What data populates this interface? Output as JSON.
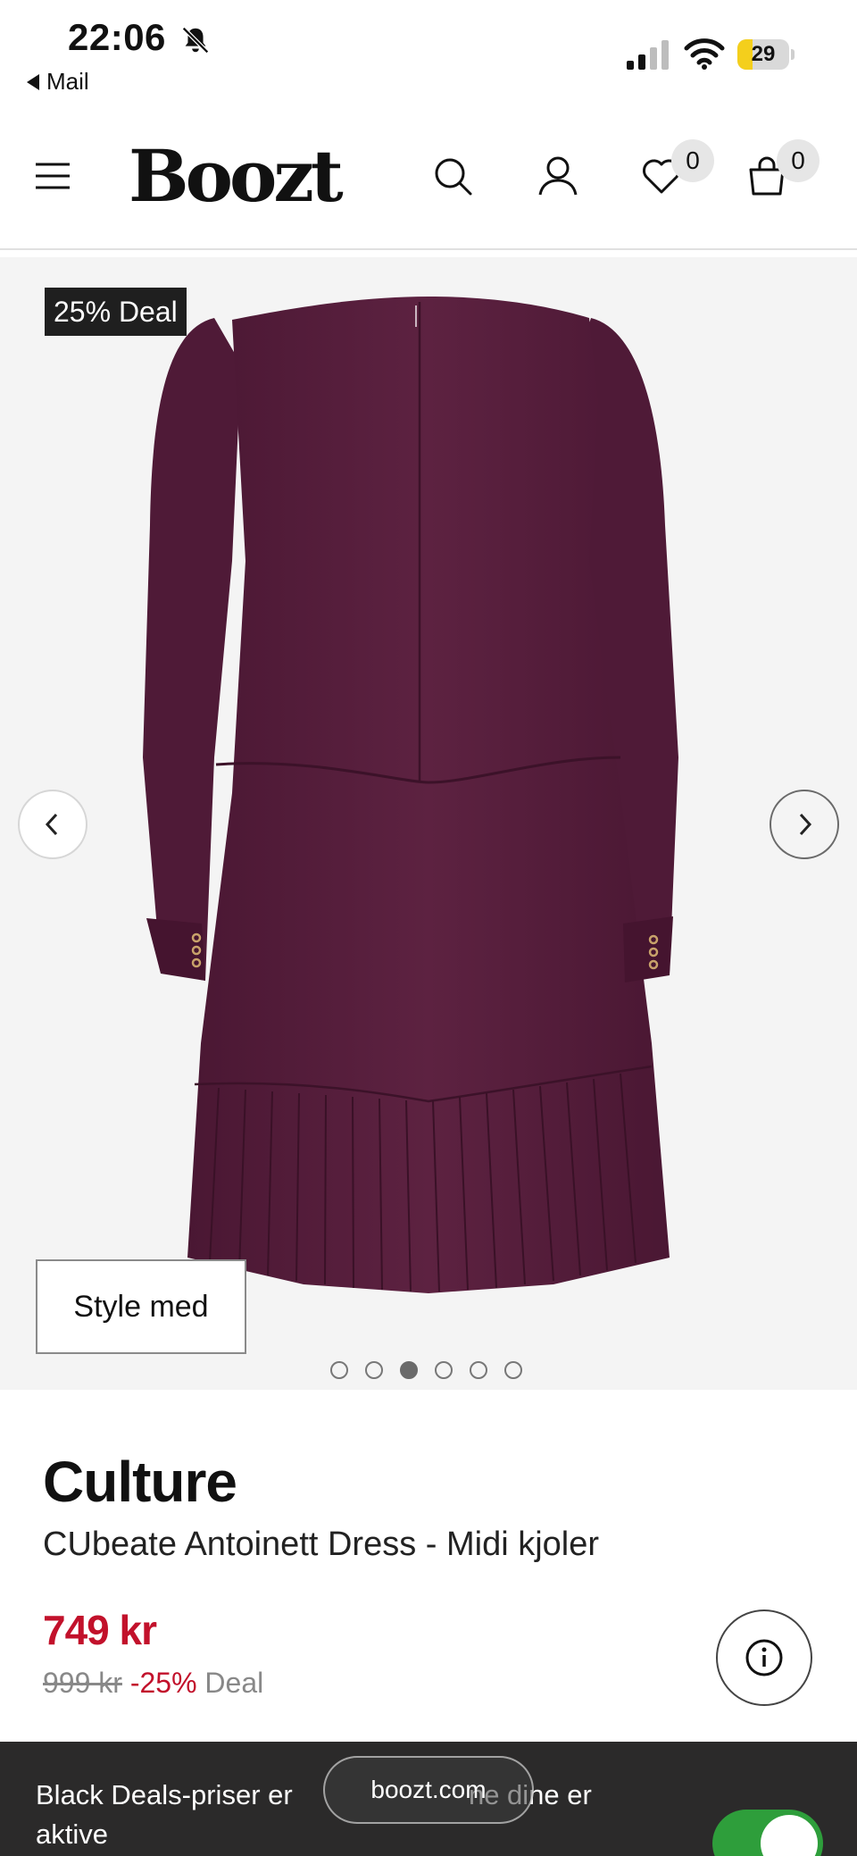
{
  "status_bar": {
    "time": "22:06",
    "back_label": "Mail",
    "battery_level": "29",
    "battery_fraction": 0.29
  },
  "header": {
    "logo": "Boozt",
    "wishlist_count": "0",
    "bag_count": "0",
    "icons": [
      "menu-icon",
      "search-icon",
      "account-icon",
      "heart-icon",
      "shopping-bag-icon"
    ]
  },
  "gallery": {
    "deal_badge": "25% Deal",
    "style_button": "Style med",
    "slide_count": 6,
    "active_slide": 3,
    "dress_color": "#5a1f3e"
  },
  "product": {
    "brand": "Culture",
    "name": "CUbeate Antoinett Dress - Midi kjoler",
    "price": "749 kr",
    "old_price": "999 kr",
    "discount": "-25%",
    "deal_label": "Deal"
  },
  "banner": {
    "text": "Black Deals-priser er aktiveret for favoritter ne dine er aktive",
    "text_left": "Black Deals-priser er",
    "text_right": "ne dine er",
    "text_line2": "aktive",
    "url": "boozt.com",
    "toggle_on": true
  },
  "colors": {
    "sale_red": "#c2112b",
    "toggle_green": "#2e9e3b",
    "banner_bg": "#2b2a2a"
  }
}
